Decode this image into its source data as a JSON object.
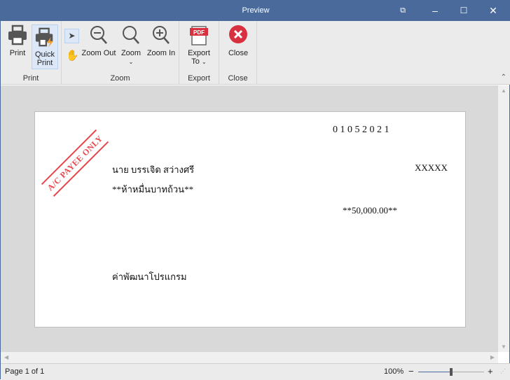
{
  "window": {
    "title": "Preview"
  },
  "ribbon": {
    "groups": [
      {
        "label": "Print"
      },
      {
        "label": "Zoom"
      },
      {
        "label": "Export"
      },
      {
        "label": "Close"
      }
    ],
    "buttons": {
      "print": "Print",
      "quick_print_1": "Quick",
      "quick_print_2": "Print",
      "zoom_out": "Zoom Out",
      "zoom": "Zoom",
      "zoom_in": "Zoom In",
      "export_1": "Export",
      "export_2": "To",
      "close": "Close"
    },
    "pdf_icon_text": "PDF"
  },
  "document": {
    "date": "0  1  0  5  2  0  2  1",
    "payee": "นาย บรรเจิด สว่างศรี",
    "amount_text": "**ห้าหมื่นบาทถ้วน**",
    "amount": "**50,000.00**",
    "bearer": "XXXXX",
    "memo": "ค่าพัฒนาโปรแกรม",
    "stamp": "A/C PAYEE ONLY"
  },
  "status": {
    "page": "Page 1 of 1",
    "zoom": "100%",
    "zoom_fraction": 0.5
  },
  "colors": {
    "titlebar": "#4a6a9b",
    "stamp": "#e8474c",
    "close": "#d9303f"
  }
}
